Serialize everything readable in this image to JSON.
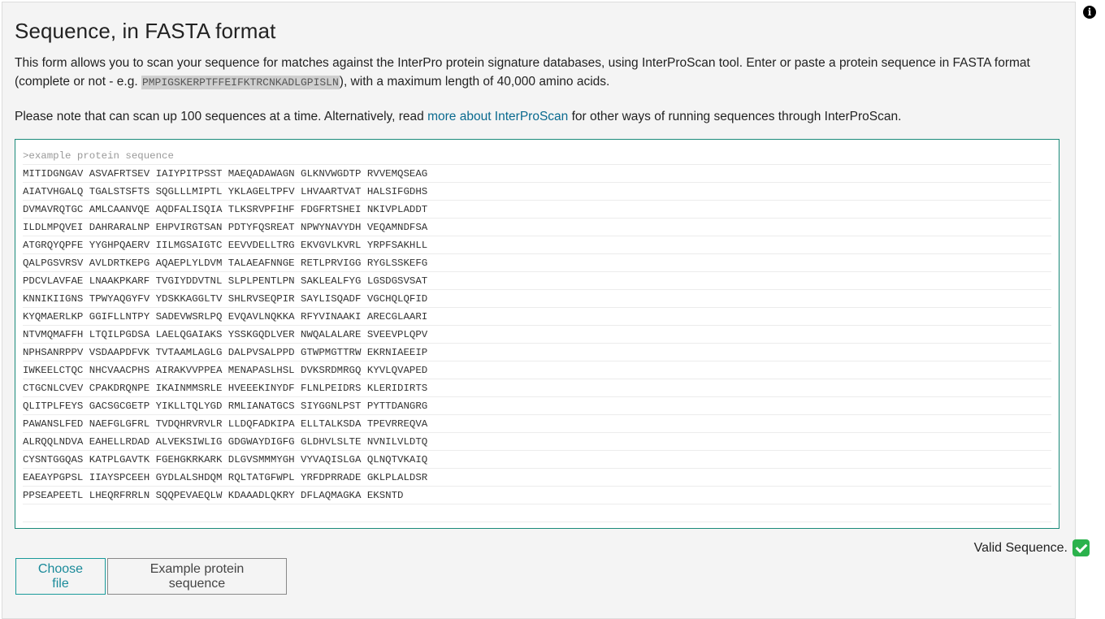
{
  "title": "Sequence, in FASTA format",
  "description": {
    "text_before": "This form allows you to scan your sequence for matches against the InterPro protein signature databases, using InterProScan tool. Enter or paste a protein sequence in FASTA format (complete or not - e.g. ",
    "example_sequence": "PMPIGSKERPTFFEIFKTRCNKADLGPISLN",
    "text_after": "), with a maximum length of 40,000 amino acids."
  },
  "note": {
    "text_before": "Please note that can scan up 100 sequences at a time. Alternatively, read ",
    "link": "more about InterProScan",
    "text_after": " for other ways of running sequences through InterProScan."
  },
  "editor": {
    "header": ">example protein sequence",
    "lines": [
      "MITIDGNGAV ASVAFRTSEV IAIYPITPSST MAEQADAWAGN GLKNVWGDTP RVVEMQSEAG",
      "AIATVHGALQ TGALSTSFTS SQGLLLMIPTL YKLAGELTPFV LHVAARTVAT HALSIFGDHS",
      "DVMAVRQTGC AMLCAANVQE AQDFALISQIA TLKSRVPFIHF FDGFRTSHEI NKIVPLADDT",
      "ILDLMPQVEI DAHRARALNP EHPVIRGTSAN PDTYFQSREAT NPWYNAVYDH VEQAMNDFSA",
      "ATGRQYQPFE YYGHPQAERV IILMGSAIGTC EEVVDELLTRG EKVGVLKVRL YRPFSAKHLL",
      "QALPGSVRSV AVLDRTKEPG AQAEPLYLDVM TALAEAFNNGE RETLPRVIGG RYGLSSKEFG",
      "PDCVLAVFAE LNAAKPKARF TVGIYDDVTNL SLPLPENTLPN SAKLEALFYG LGSDGSVSAT",
      "KNNIKIIGNS TPWYAQGYFV YDSKKAGGLTV SHLRVSEQPIR SAYLISQADF VGCHQLQFID",
      "KYQMAERLKP GGIFLLNTPY SADEVWSRLPQ EVQAVLNQKKA RFYVINAAKI ARECGLAARI",
      "NTVMQMAFFH LTQILPGDSA LAELQGAIAKS YSSKGQDLVER NWQALALARE SVEEVPLQPV",
      "NPHSANRPPV VSDAAPDFVK TVTAAMLAGLG DALPVSALPPD GTWPMGTTRW EKRNIAEEIP",
      "IWKEELCTQC NHCVAACPHS AIRAKVVPPEA MENAPASLHSL DVKSRDMRGQ KYVLQVAPED",
      "CTGCNLCVEV CPAKDRQNPE IKAINMMSRLE HVEEEKINYDF FLNLPEIDRS KLERIDIRTS",
      "QLITPLFEYS GACSGCGETP YIKLLTQLYGD RMLIANATGCS SIYGGNLPST PYTTDANGRG",
      "PAWANSLFED NAEFGLGFRL TVDQHRVRVLR LLDQFADKIPA ELLTALKSDA TPEVRREQVA",
      "ALRQQLNDVA EAHELLRDAD ALVEKSIWLIG GDGWAYDIGFG GLDHVLSLTE NVNILVLDTQ",
      "CYSNTGGQAS KATPLGAVTK FGEHGKRKARK DLGVSMMMYGH VYVAQISLGA QLNQTVKAIQ",
      "EAEAYPGPSL IIAYSPCEEH GYDLALSHDQM RQLTATGFWPL YRFDPRRADE GKLPLALDSR",
      "PPSEAPEETL LHEQRFRRLN SQQPEVAEQLW KDAAADLQKRY DFLAQMAGKA EKSNTD"
    ]
  },
  "status": {
    "valid_text": "Valid Sequence.",
    "valid_color": "#2bb24c"
  },
  "buttons": {
    "choose_file": "Choose file",
    "example": "Example protein sequence"
  },
  "colors": {
    "accent": "#1a8a7a",
    "link": "#0a6a8f",
    "panel_bg": "#f4f4f4"
  }
}
